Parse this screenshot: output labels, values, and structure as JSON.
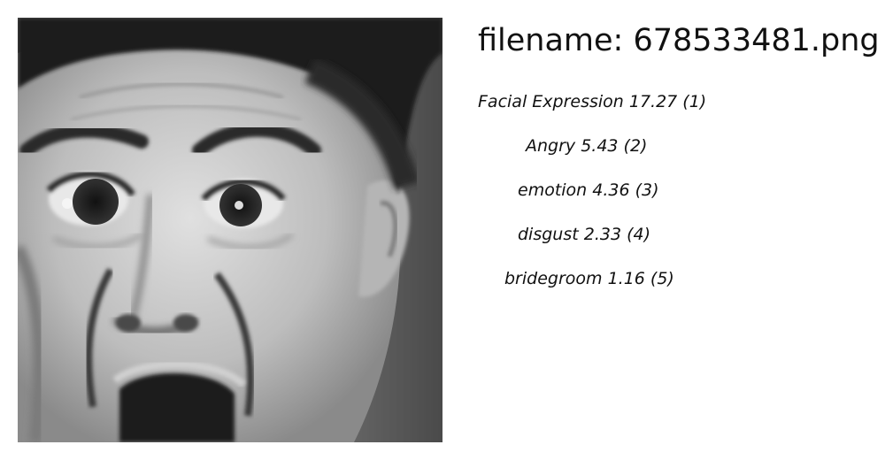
{
  "filename_label": "filename: 678533481.png",
  "image": {
    "icon": "face-photo",
    "alt": "grayscale face photo"
  },
  "tags": [
    {
      "text": "Facial Expression 17.27 (1)"
    },
    {
      "text": "Angry  5.43 (2)"
    },
    {
      "text": "emotion  4.36 (3)"
    },
    {
      "text": "disgust  2.33 (4)"
    },
    {
      "text": "bridegroom  1.16 (5)"
    }
  ]
}
